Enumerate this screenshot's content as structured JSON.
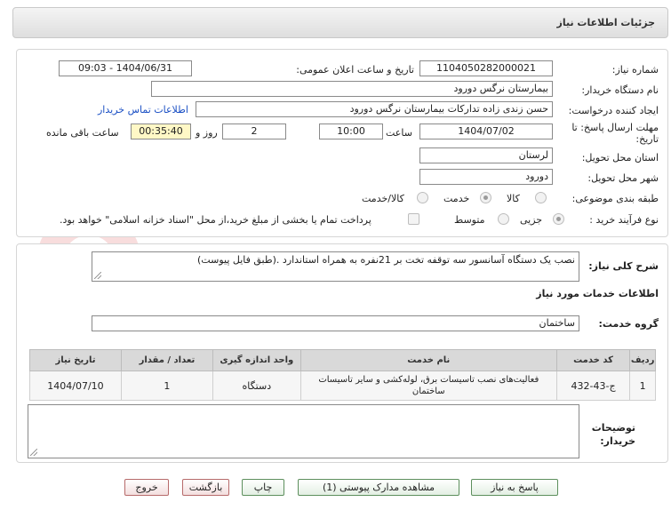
{
  "header": {
    "title": "جزئیات اطلاعات نیاز"
  },
  "form": {
    "need_number_label": "شماره نیاز:",
    "need_number": "1104050282000021",
    "announce_label": "تاریخ و ساعت اعلان عمومی:",
    "announce_value": "1404/06/31 - 09:03",
    "buyer_label": "نام دستگاه خریدار:",
    "buyer_value": "بیمارستان نرگس دورود",
    "creator_label": "ایجاد کننده درخواست:",
    "creator_value": "حسن  زندی زاده  تدارکات بیمارستان نرگس دورود",
    "contact_link": "اطلاعات تماس خریدار",
    "deadline_label_1": "مهلت ارسال پاسخ: تا",
    "deadline_label_2": "تاریخ:",
    "deadline_date": "1404/07/02",
    "time_label": "ساعت",
    "deadline_time": "10:00",
    "days_value": "2",
    "days_label": "روز و",
    "remaining_value": "00:35:40",
    "remaining_label": "ساعت باقی مانده",
    "province_label": "استان محل تحویل:",
    "province_value": "لرستان",
    "city_label": "شهر محل تحویل:",
    "city_value": "دورود",
    "category_label": "طبقه بندی موضوعی:",
    "category_options": [
      "کالا",
      "خدمت",
      "کالا/خدمت"
    ],
    "process_label": "نوع فرآیند خرید :",
    "process_options": [
      "جزیی",
      "متوسط"
    ],
    "payment_note": "پرداخت تمام یا بخشی از مبلغ خرید،از محل \"اسناد خزانه اسلامی\" خواهد بود."
  },
  "details": {
    "description_label": "شرح کلی نیاز:",
    "description_value": "نصب یک دستگاه آسانسور سه توقفه تخت بر 21نفره به همراه استاندارد .(طبق فایل پیوست)",
    "services_title": "اطلاعات خدمات مورد نیاز",
    "service_group_label": "گروه خدمت:",
    "service_group_value": "ساختمان"
  },
  "table": {
    "columns": [
      "ردیف",
      "کد خدمت",
      "نام خدمت",
      "واحد اندازه گیری",
      "تعداد / مقدار",
      "تاریخ نیاز"
    ],
    "rows": [
      [
        "1",
        "ج-43-432",
        "فعالیت‌های نصب تاسیسات برق، لوله‌کشی و سایر تاسیسات ساختمان",
        "دستگاه",
        "1",
        "1404/07/10"
      ]
    ]
  },
  "buyer_notes_label_1": "توضیحات",
  "buyer_notes_label_2": "خریدار:",
  "buttons": {
    "reply": "پاسخ به نیاز",
    "attachments": "مشاهده مدارک پیوستی (1)",
    "print": "چاپ",
    "back": "بازگشت",
    "exit": "خروج"
  },
  "colors": {
    "link": "#1a4fc4",
    "remaining_bg": "#fff8c6",
    "button_border": "#5d8f5d",
    "button_red_border": "#b76b6b"
  }
}
